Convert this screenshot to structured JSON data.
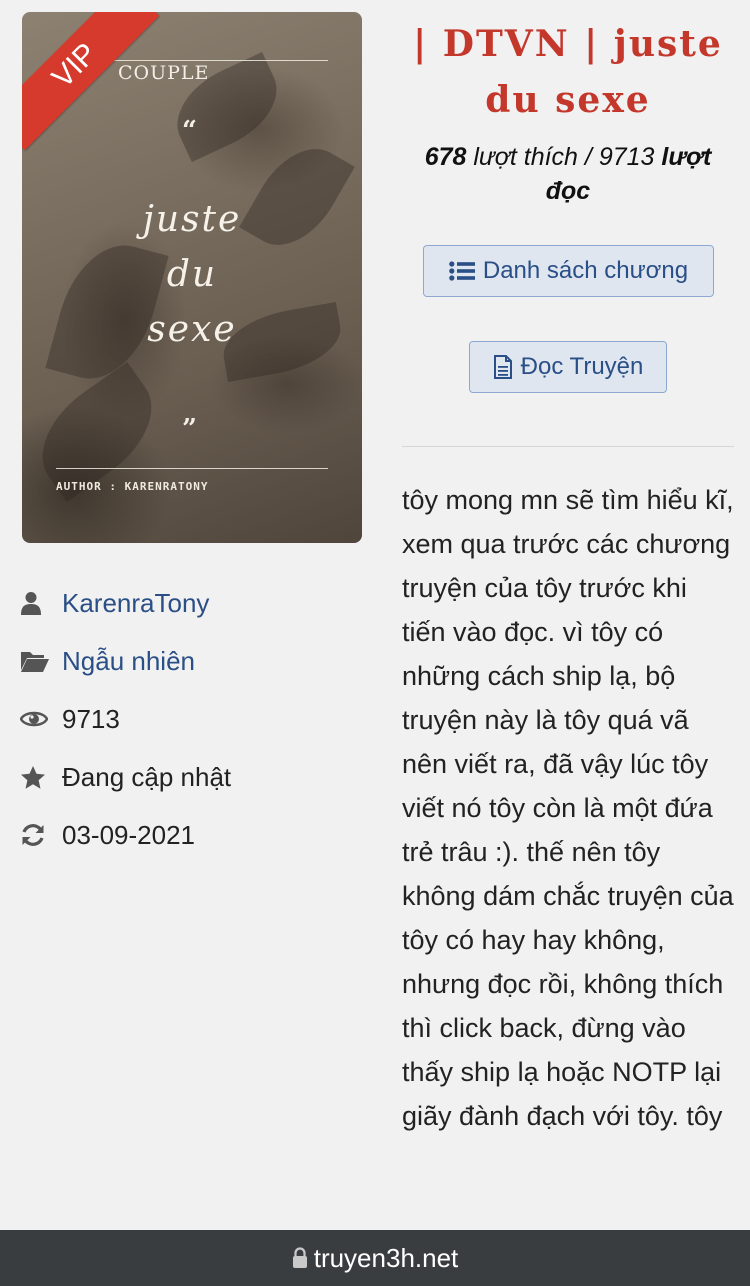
{
  "story": {
    "title": "| DTVN | juste du sexe",
    "likes": "678",
    "likes_label": "lượt thích /",
    "views": "9713",
    "views_label": "lượt đọc",
    "description": "tôy mong mn sẽ tìm hiểu kĩ, xem qua trước các chương truyện của tôy trước khi tiến vào đọc. vì tôy có những cách ship lạ, bộ truyện này là tôy quá vã nên viết ra, đã vậy lúc tôy viết nó tôy còn là một đứa trẻ trâu :). thế nên tôy không dám chắc truyện của tôy có hay hay không, nhưng đọc rồi, không thích thì click back, đừng vào thấy ship lạ hoặc NOTP lại giãy đành đạch với tôy. tôy"
  },
  "cover": {
    "badge": "VIP",
    "top_text": "COUPLE",
    "open_quote": "“",
    "title_lines": [
      "juste",
      "du",
      "sexe"
    ],
    "close_quote": "”",
    "author_line": "AUTHOR : KARENRATONY"
  },
  "meta": {
    "author": "KarenraTony",
    "genre": "Ngẫu nhiên",
    "view_count": "9713",
    "status": "Đang cập nhật",
    "updated": "03-09-2021"
  },
  "buttons": {
    "chapters": "Danh sách chương",
    "read": "Đọc Truyện"
  },
  "browser": {
    "url": "truyen3h.net"
  },
  "colors": {
    "title": "#c4372b",
    "link": "#2a4f86",
    "vip_badge": "#d63a2c",
    "bottom_bar": "#3a3d40"
  },
  "icons": {
    "author": "user-icon",
    "genre": "folder-open-icon",
    "views": "eye-icon",
    "status": "star-icon",
    "updated": "refresh-icon",
    "chapters": "list-icon",
    "read": "document-icon",
    "url": "lock-icon"
  }
}
